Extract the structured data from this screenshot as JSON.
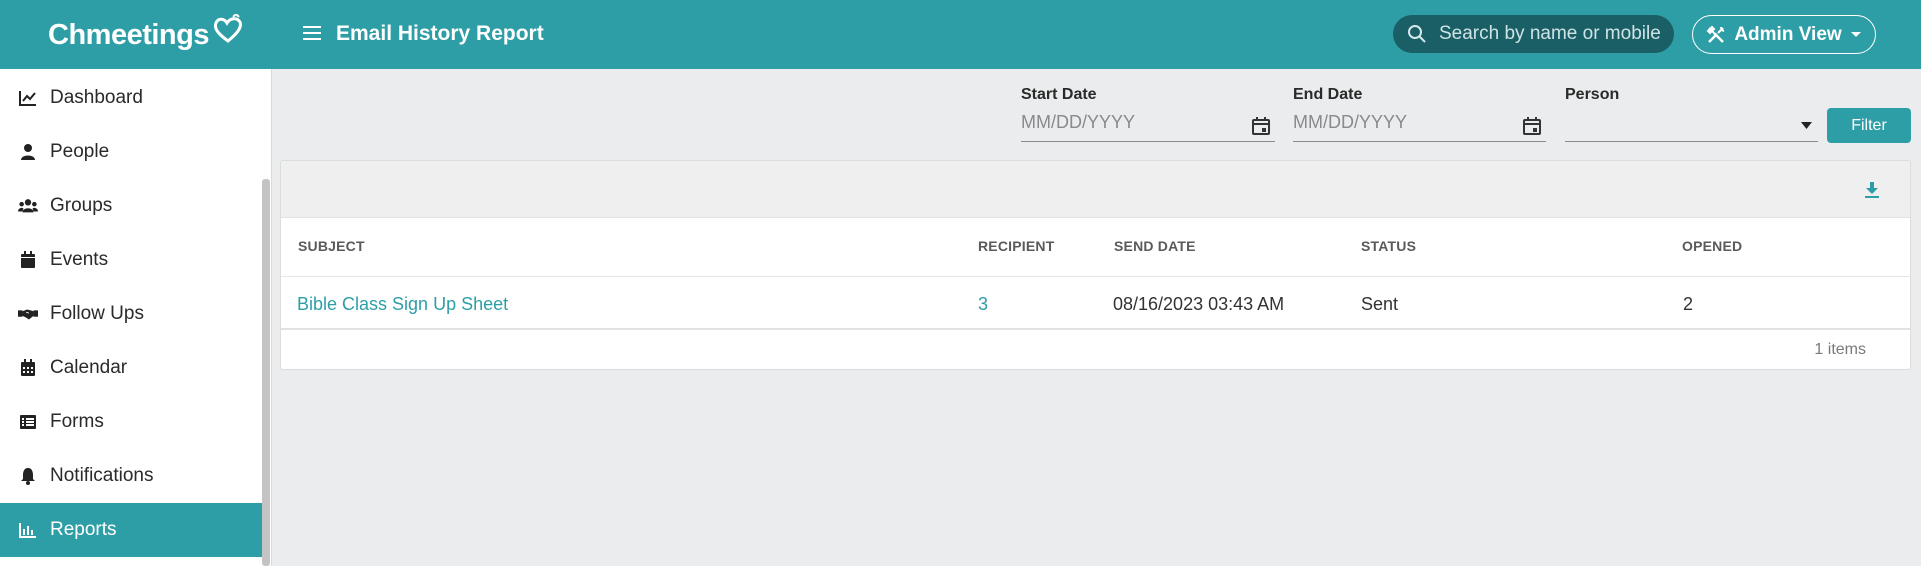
{
  "app": {
    "logo_text": "Chmeetings",
    "page_title": "Email History Report"
  },
  "header": {
    "search_placeholder": "Search by name or mobile",
    "admin_label": "Admin View"
  },
  "sidebar": {
    "items": [
      {
        "label": "Dashboard",
        "icon": "chart-line-icon"
      },
      {
        "label": "People",
        "icon": "person-icon"
      },
      {
        "label": "Groups",
        "icon": "users-icon"
      },
      {
        "label": "Events",
        "icon": "calendar-day-icon"
      },
      {
        "label": "Follow Ups",
        "icon": "handshake-icon"
      },
      {
        "label": "Calendar",
        "icon": "calendar-icon"
      },
      {
        "label": "Forms",
        "icon": "list-icon"
      },
      {
        "label": "Notifications",
        "icon": "bell-icon"
      },
      {
        "label": "Reports",
        "icon": "bar-chart-icon",
        "active": true
      }
    ]
  },
  "filters": {
    "start_date": {
      "label": "Start Date",
      "placeholder": "MM/DD/YYYY",
      "value": ""
    },
    "end_date": {
      "label": "End Date",
      "placeholder": "MM/DD/YYYY",
      "value": ""
    },
    "person": {
      "label": "Person",
      "value": ""
    },
    "filter_label": "Filter"
  },
  "table": {
    "columns": [
      "SUBJECT",
      "RECIPIENT",
      "SEND DATE",
      "STATUS",
      "OPENED"
    ],
    "rows": [
      {
        "subject": "Bible Class Sign Up Sheet",
        "recipient": "3",
        "send_date": "08/16/2023 03:43 AM",
        "status": "Sent",
        "opened": "2"
      }
    ],
    "items_count": "1 items"
  },
  "colors": {
    "brand": "#2e9ea6",
    "search_bg": "#1a5f66",
    "page_bg": "#eaeced"
  }
}
